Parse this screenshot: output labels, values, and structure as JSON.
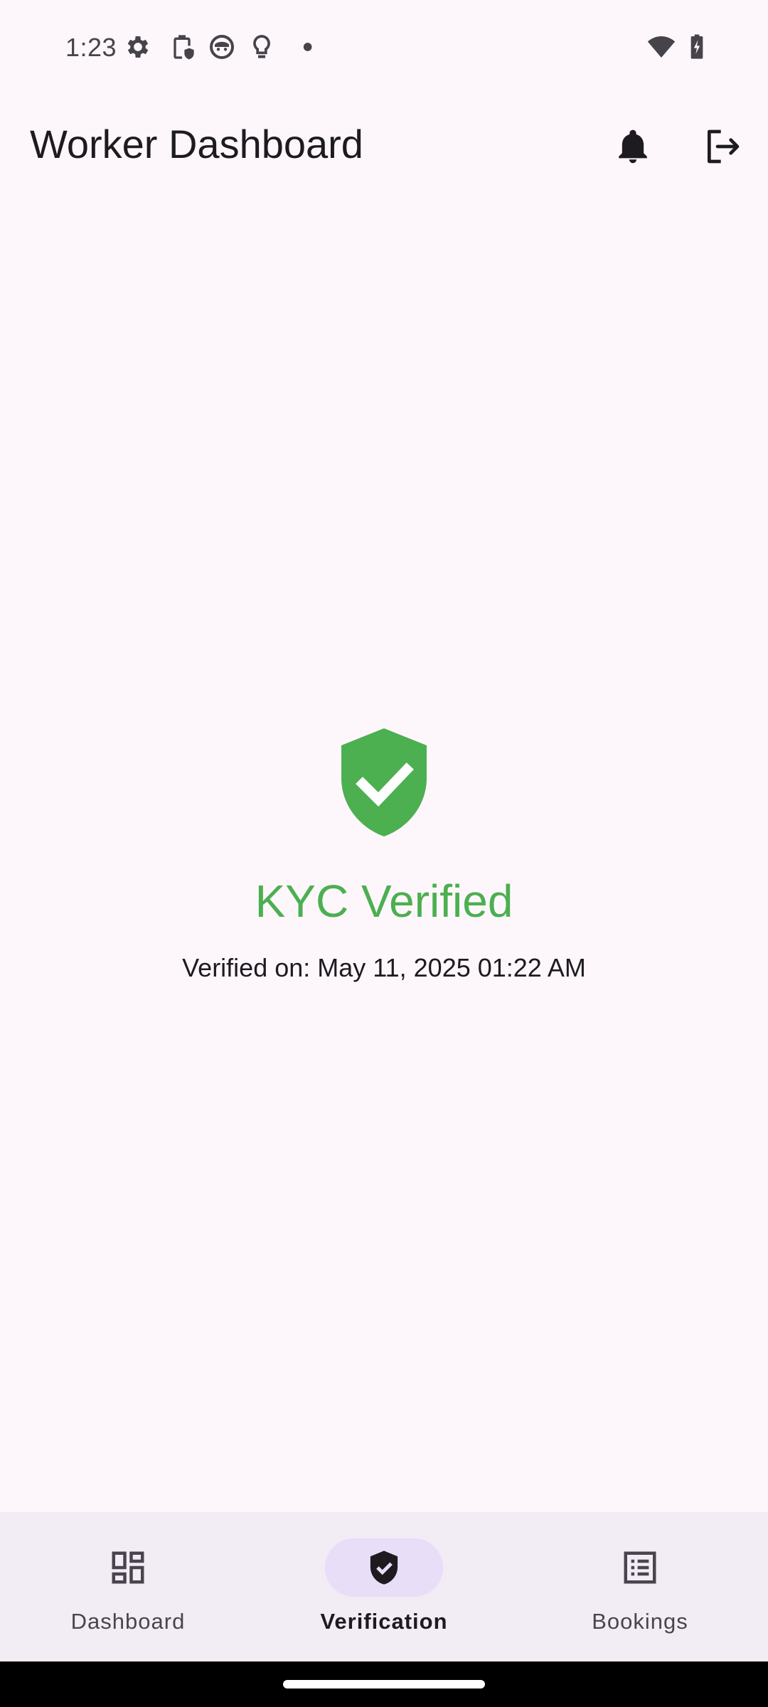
{
  "status_bar": {
    "time": "1:23",
    "icons": [
      "settings-icon",
      "clipboard-shield-icon",
      "face-icon",
      "lightbulb-icon",
      "dot-icon",
      "wifi-icon",
      "battery-charging-icon"
    ]
  },
  "app_bar": {
    "title": "Worker Dashboard",
    "actions": [
      "bell-icon",
      "logout-icon"
    ]
  },
  "kyc": {
    "status": "KYC Verified",
    "verified_on": "Verified on: May 11, 2025 01:22 AM",
    "color": "#4CAF50"
  },
  "bottom_nav": {
    "items": [
      {
        "label": "Dashboard",
        "icon": "dashboard-icon",
        "active": false
      },
      {
        "label": "Verification",
        "icon": "verified-shield-icon",
        "active": true
      },
      {
        "label": "Bookings",
        "icon": "list-icon",
        "active": false
      }
    ]
  },
  "colors": {
    "background": "#FDF7FC",
    "nav_background": "#F2ECF4",
    "nav_indicator": "#E8DEF8",
    "success": "#4CAF50"
  }
}
